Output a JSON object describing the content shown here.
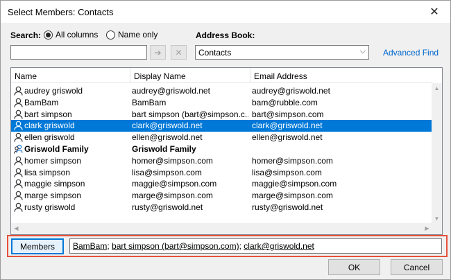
{
  "window": {
    "title": "Select Members: Contacts",
    "close_glyph": "✕"
  },
  "search": {
    "label": "Search:",
    "option_all": "All columns",
    "option_name": "Name only",
    "selected": "All columns",
    "value": "",
    "go_glyph": "➔",
    "clear_glyph": "✕"
  },
  "address_book": {
    "label": "Address Book:",
    "value": "Contacts",
    "advanced_find": "Advanced Find"
  },
  "columns": [
    "Name",
    "Display Name",
    "Email Address"
  ],
  "rows": [
    {
      "name": "audrey griswold",
      "display": "audrey@griswold.net",
      "email": "audrey@griswold.net",
      "icon": "contact-icon"
    },
    {
      "name": "BamBam",
      "display": "BamBam",
      "email": "bam@rubble.com",
      "icon": "contact-icon"
    },
    {
      "name": "bart simpson",
      "display": "bart simpson (bart@simpson.c...",
      "email": "bart@simpson.com",
      "icon": "contact-icon"
    },
    {
      "name": "clark griswold",
      "display": "clark@griswold.net",
      "email": "clark@griswold.net",
      "icon": "contact-icon",
      "selected": true
    },
    {
      "name": "ellen griswold",
      "display": "ellen@griswold.net",
      "email": "ellen@griswold.net",
      "icon": "contact-icon"
    },
    {
      "name": "Griswold Family",
      "display": "Griswold Family",
      "email": "",
      "icon": "group-icon",
      "bold": true
    },
    {
      "name": "homer simpson",
      "display": "homer@simpson.com",
      "email": "homer@simpson.com",
      "icon": "contact-icon"
    },
    {
      "name": "lisa simpson",
      "display": "lisa@simpson.com",
      "email": "lisa@simpson.com",
      "icon": "contact-icon"
    },
    {
      "name": "maggie simpson",
      "display": "maggie@simpson.com",
      "email": "maggie@simpson.com",
      "icon": "contact-icon"
    },
    {
      "name": "marge simpson",
      "display": "marge@simpson.com",
      "email": "marge@simpson.com",
      "icon": "contact-icon"
    },
    {
      "name": "rusty griswold",
      "display": "rusty@griswold.net",
      "email": "rusty@griswold.net",
      "icon": "contact-icon"
    }
  ],
  "members": {
    "button_label": "Members",
    "recipients": [
      "BamBam",
      "bart simpson (bart@simpson.com)",
      "clark@griswold.net"
    ],
    "separator": "; "
  },
  "buttons": {
    "ok": "OK",
    "cancel": "Cancel"
  },
  "colors": {
    "selection": "#0078d7",
    "link": "#0066cc",
    "highlight_border": "#e8503a"
  }
}
